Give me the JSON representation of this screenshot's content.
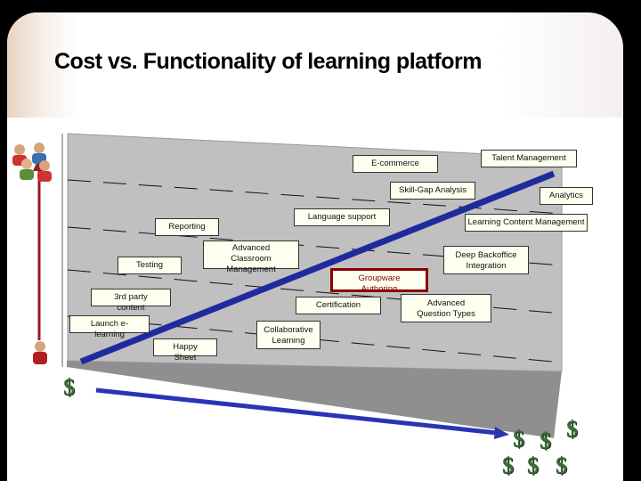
{
  "title": "Cost vs. Functionality of learning platform",
  "features": [
    {
      "label": "E-commerce"
    },
    {
      "label": "Talent Management"
    },
    {
      "label": "Skill-Gap Analysis"
    },
    {
      "label": "Analytics"
    },
    {
      "label": "Language support"
    },
    {
      "label": "Learning Content Management"
    },
    {
      "label": "Reporting"
    },
    {
      "label": "Advanced Classroom Management"
    },
    {
      "label": "Testing"
    },
    {
      "label": "Deep Backoffice Integration"
    },
    {
      "label": "Groupware Authoring",
      "highlighted": true
    },
    {
      "label": "3rd party content"
    },
    {
      "label": "Certification"
    },
    {
      "label": "Advanced Question Types"
    },
    {
      "label": "Launch e-learning"
    },
    {
      "label": "Collaborative Learning"
    },
    {
      "label": "Happy Sheet"
    }
  ],
  "cost_symbol": "$",
  "colors": {
    "trend_line": "#1f2a9e",
    "cost_arrow": "#2b33b5",
    "users_arrow": "#9b1c1c",
    "highlight": "#8b0000",
    "dollar": "#3d6b3a"
  },
  "icons": [
    "users-group-icon",
    "single-user-icon",
    "dollar-icon"
  ]
}
